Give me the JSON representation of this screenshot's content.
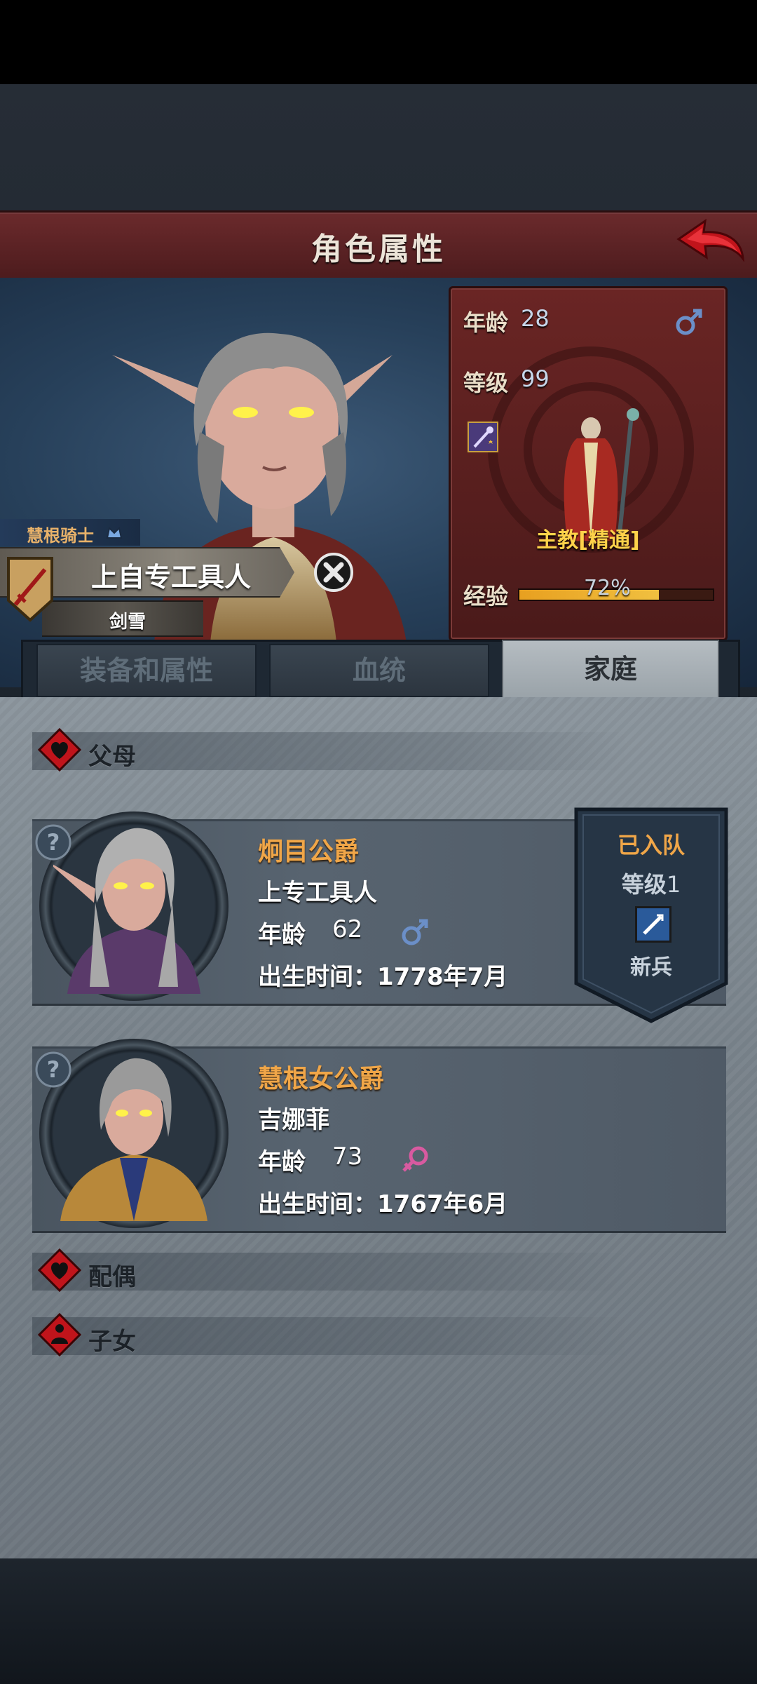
{
  "header": {
    "title": "角色属性"
  },
  "character": {
    "rank_tag": "慧根骑士",
    "name": "上自专工具人",
    "sub_name": "剑雪"
  },
  "stats": {
    "age_label": "年龄",
    "age_value": "28",
    "level_label": "等级",
    "level_value": "99",
    "class_name": "主教[精通]",
    "exp_label": "经验",
    "exp_value": "72%",
    "exp_fraction": 0.72,
    "gender": "male"
  },
  "tabs": [
    {
      "label": "装备和属性",
      "active": false
    },
    {
      "label": "血统",
      "active": false
    },
    {
      "label": "家庭",
      "active": true
    }
  ],
  "sections": {
    "parents": "父母",
    "spouse": "配偶",
    "children": "子女"
  },
  "parents": [
    {
      "name": "炯目公爵",
      "title": "上专工具人",
      "age_label": "年龄",
      "age": "62",
      "gender": "male",
      "birth": "出生时间：1778年7月"
    },
    {
      "name": "慧根女公爵",
      "title": "吉娜菲",
      "age_label": "年龄",
      "age": "73",
      "gender": "female",
      "birth": "出生时间：1767年6月"
    }
  ],
  "party_badge": {
    "status": "已入队",
    "level_label": "等级",
    "level_value": "1",
    "role": "新兵"
  },
  "colors": {
    "accent_orange": "#f0a648",
    "male": "#6b8fc8",
    "female": "#d85aa0",
    "title_bar": "#5a2022"
  }
}
